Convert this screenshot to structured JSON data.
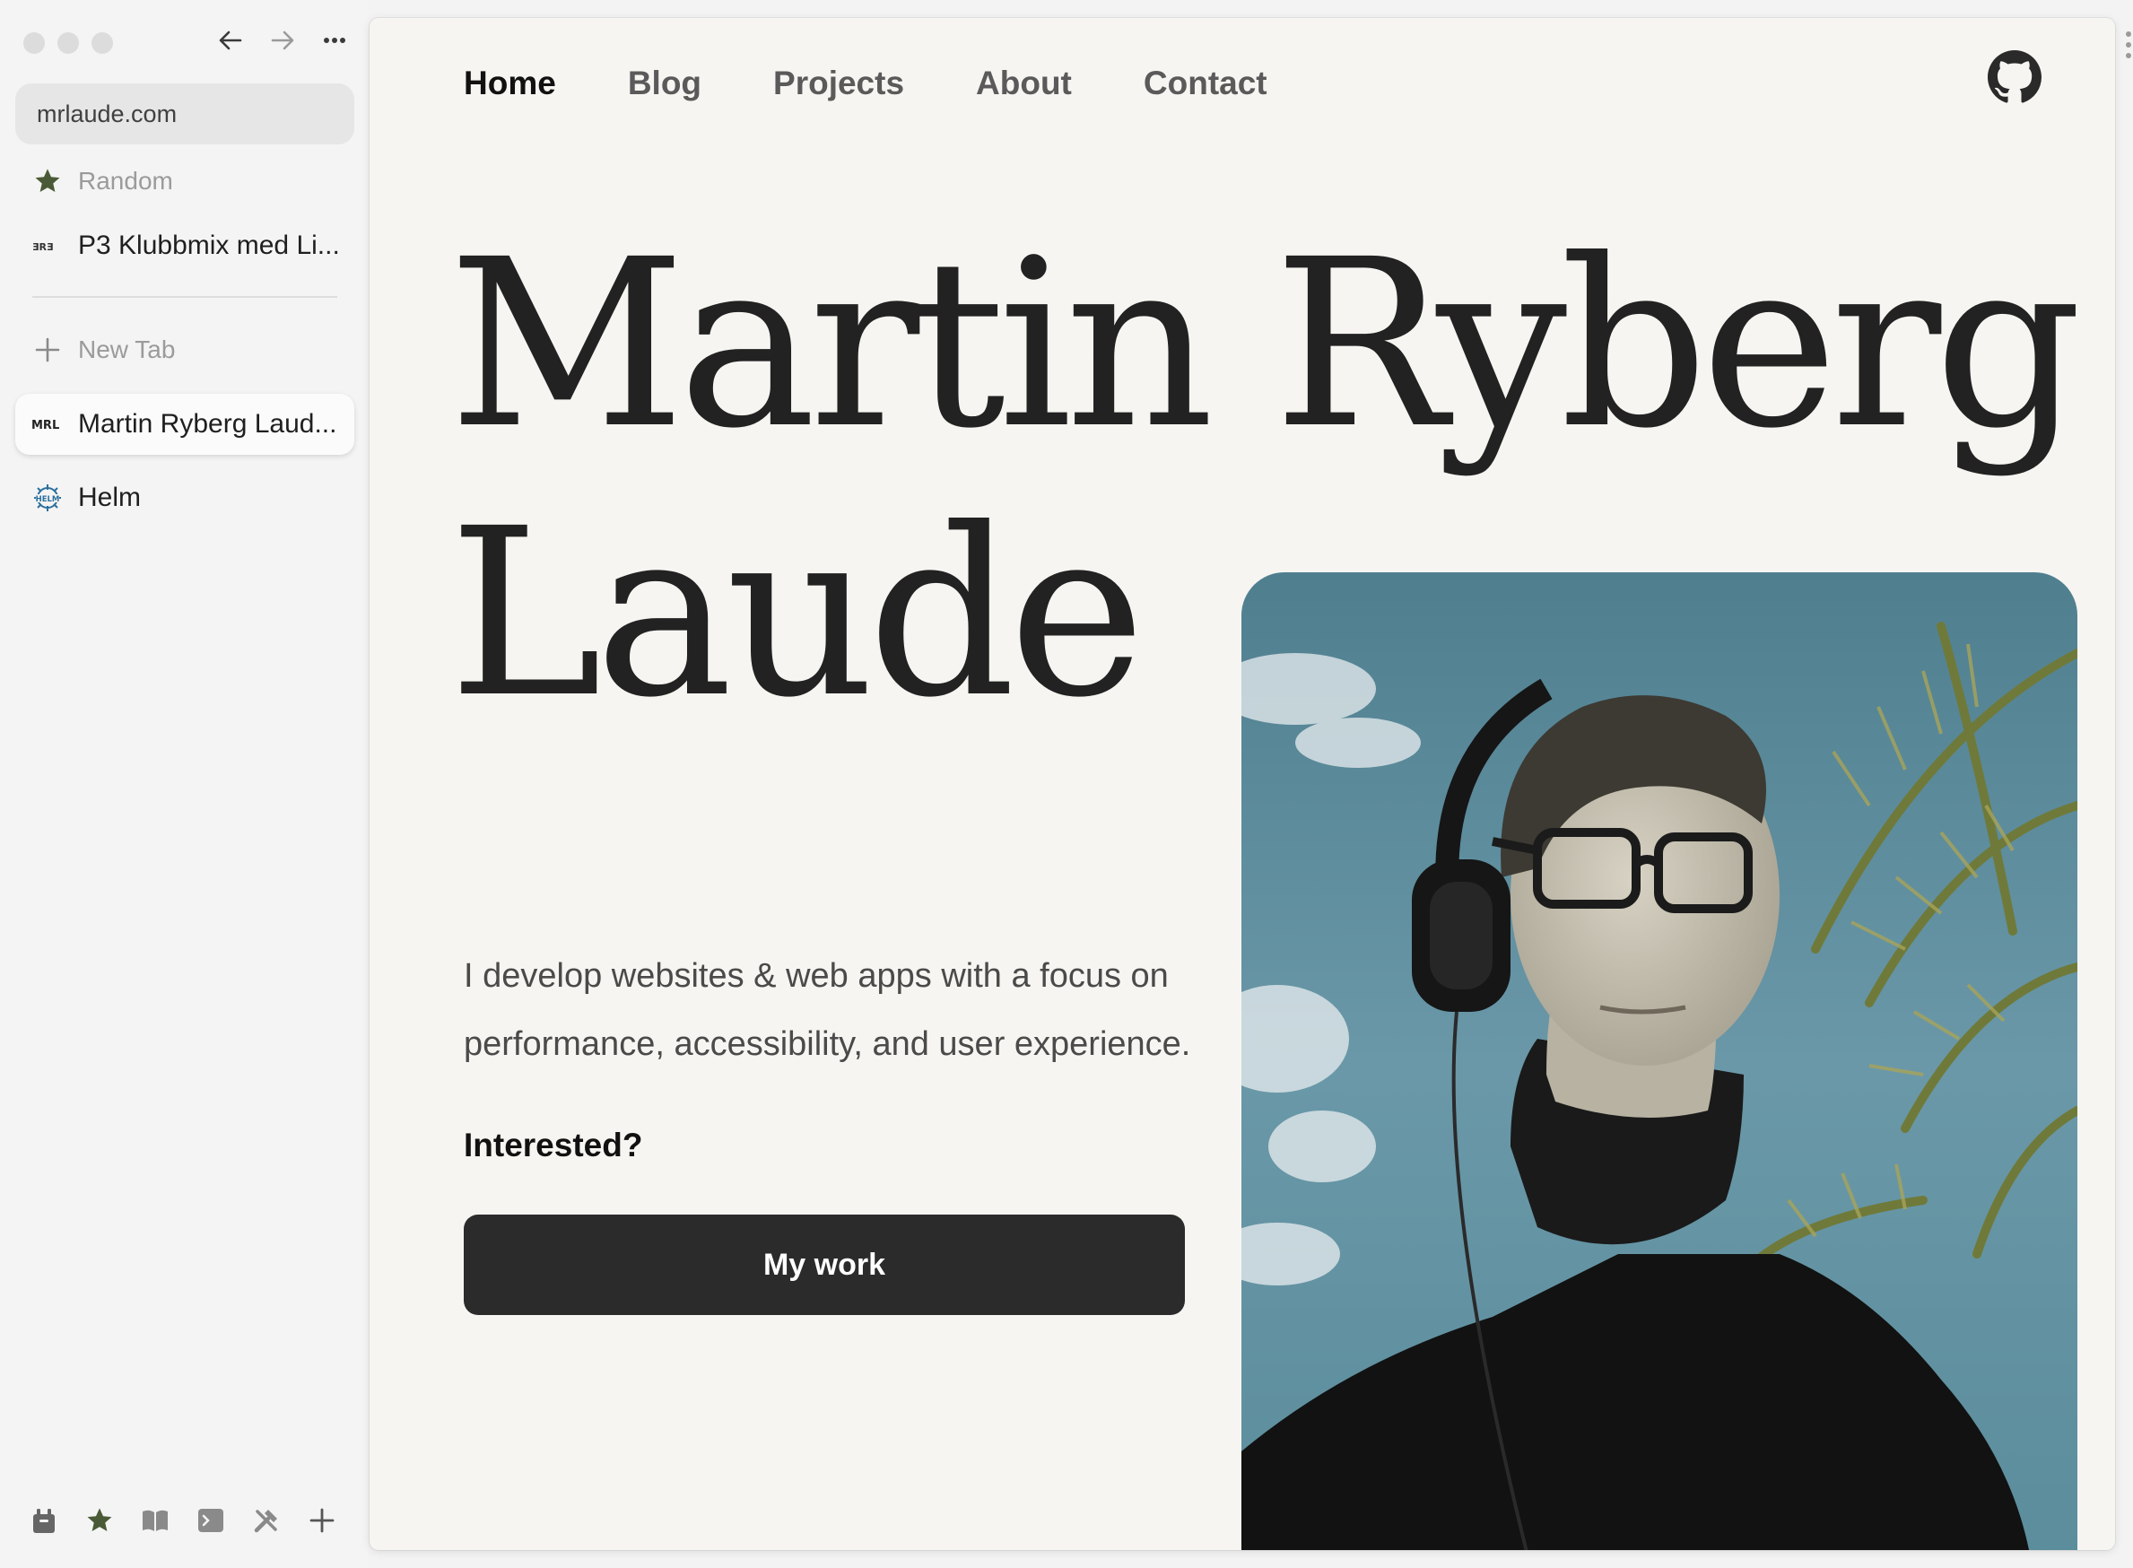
{
  "sidebar": {
    "url": "mrlaude.com",
    "favorites": [
      {
        "label": "Random",
        "icon": "star-icon"
      },
      {
        "label": "P3 Klubbmix med Li...",
        "icon": "p3-favicon"
      }
    ],
    "new_tab": "New Tab",
    "tabs": [
      {
        "label": "Martin Ryberg Laud...",
        "favicon_text": "MRL",
        "active": true
      },
      {
        "label": "Helm",
        "favicon_text": "HELM",
        "active": false
      }
    ],
    "bottom_tools": [
      "archive-icon",
      "star-icon",
      "book-icon",
      "terminal-icon",
      "tools-icon",
      "plus-icon"
    ]
  },
  "site": {
    "nav": [
      "Home",
      "Blog",
      "Projects",
      "About",
      "Contact"
    ],
    "current_nav": "Home",
    "hero": {
      "line1": "Martin Ryberg",
      "line2": "Laude"
    },
    "intro": "I develop websites & web apps with a focus on performance, accessibility, and user experience.",
    "interested": "Interested?",
    "cta": "My work"
  },
  "colors": {
    "page_bg": "#f6f5f1",
    "button_bg": "#2b2b2b",
    "star_accent": "#4a5a36",
    "helm_blue": "#2b6f9e",
    "sky": "#5d8c9c"
  }
}
